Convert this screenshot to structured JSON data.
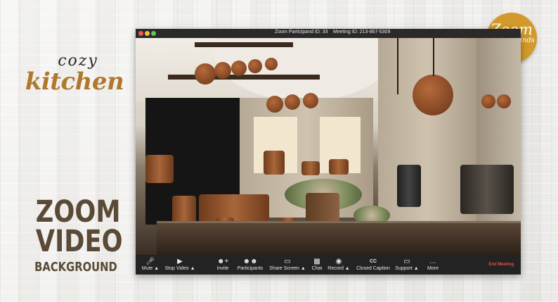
{
  "branding": {
    "cozy": "cozy",
    "kitchen": "kitchen",
    "zoom_line1": "ZOOM",
    "zoom_line2": "VIDEO",
    "background": "BACKGROUND"
  },
  "badge": {
    "line1": "Zoom",
    "line2": "backgrounds",
    "color": "#d19a2a"
  },
  "window": {
    "participant_id": "Zoom Participand ID: 33",
    "meeting_id": "Meeting ID: 213-867-5309"
  },
  "toolbar": {
    "items": [
      {
        "label": "Mute",
        "icon": "microphone-icon",
        "caret": true
      },
      {
        "label": "Stop Video",
        "icon": "video-camera-icon",
        "caret": true
      },
      {
        "label": "Invite",
        "icon": "add-person-icon"
      },
      {
        "label": "Participants",
        "icon": "participants-icon"
      },
      {
        "label": "Share Screen",
        "icon": "share-screen-icon",
        "caret": true
      },
      {
        "label": "Chat",
        "icon": "chat-icon"
      },
      {
        "label": "Record",
        "icon": "record-icon",
        "caret": true
      },
      {
        "label": "Closed Caption",
        "icon": "cc-icon"
      },
      {
        "label": "Support",
        "icon": "support-icon",
        "caret": true
      },
      {
        "label": "More",
        "icon": "more-icon"
      }
    ],
    "end_meeting": "End Meeting",
    "end_color": "#e0504a"
  }
}
